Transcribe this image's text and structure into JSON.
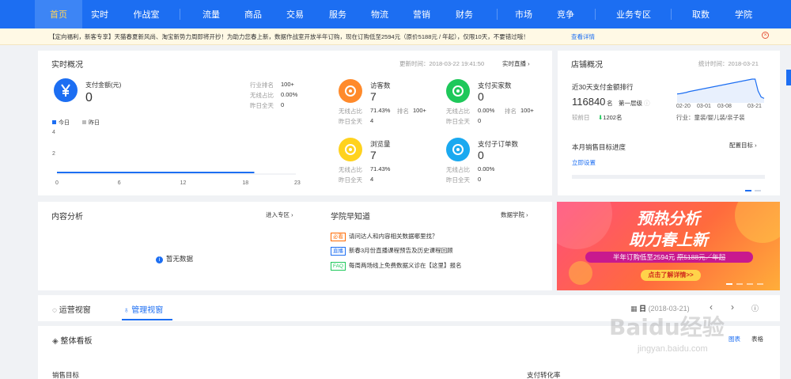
{
  "nav": {
    "items": [
      "首页",
      "实时",
      "作战室",
      "流量",
      "商品",
      "交易",
      "服务",
      "物流",
      "营销",
      "财务",
      "市场",
      "竞争",
      "业务专区",
      "取数",
      "学院"
    ],
    "active": "首页"
  },
  "notice": {
    "text": "【定向福利，新客专享】天猫春夏新风尚、淘宝新势力周即将开抄！为助力您春上新，数据作战室开放半年订购，现在订购低至2594元（原价5188元 / 年起），仅限10天，不要错过哦！",
    "link": "查看详情"
  },
  "realtime": {
    "title": "实时概况",
    "update_time": "更新时间：2018-03-22 19:41:50",
    "live_link": "实时直播",
    "pay_amount": {
      "label": "支付金额(元)",
      "value": "0"
    },
    "rank_rows": [
      {
        "label": "行业排名",
        "value": "100+"
      },
      {
        "label": "无线占比",
        "value": "0.00%"
      },
      {
        "label": "昨日全天",
        "value": "0"
      }
    ],
    "legend": {
      "today": "今日",
      "yesterday": "昨日"
    },
    "chart_data": {
      "type": "line",
      "x_ticks": [
        "0",
        "6",
        "12",
        "18",
        "23"
      ],
      "y_ticks": [
        "4",
        "2"
      ],
      "series": [
        {
          "name": "今日",
          "x": [
            0,
            19
          ],
          "values": [
            0,
            0
          ]
        }
      ],
      "xlim": [
        0,
        23
      ],
      "ylim": [
        0,
        4
      ]
    },
    "metrics": [
      {
        "name": "访客数",
        "value": "7",
        "r1_label": "无线占比",
        "r1_value": "71.43%",
        "r1_extra_label": "排名",
        "r1_extra_value": "100+",
        "r2_label": "昨日全天",
        "r2_value": "4",
        "icon": "footprint-icon",
        "color": "#ff8a2b"
      },
      {
        "name": "支付买家数",
        "value": "0",
        "r1_label": "无线占比",
        "r1_value": "0.00%",
        "r1_extra_label": "排名",
        "r1_extra_value": "100+",
        "r2_label": "昨日全天",
        "r2_value": "0",
        "icon": "users-icon",
        "color": "#1ec85a"
      },
      {
        "name": "浏览量",
        "value": "7",
        "r1_label": "无线占比",
        "r1_value": "71.43%",
        "r1_extra_label": "",
        "r1_extra_value": "",
        "r2_label": "昨日全天",
        "r2_value": "4",
        "icon": "eye-icon",
        "color": "#ffd21e"
      },
      {
        "name": "支付子订单数",
        "value": "0",
        "r1_label": "无线占比",
        "r1_value": "0.00%",
        "r1_extra_label": "",
        "r1_extra_value": "",
        "r2_label": "昨日全天",
        "r2_value": "0",
        "icon": "order-icon",
        "color": "#1aa9f0"
      }
    ]
  },
  "store": {
    "title": "店铺概况",
    "stat_time": "统计时间：2018-03-21",
    "rank_title": "近30天支付金额排行",
    "rank_value": "116840",
    "rank_unit": "名",
    "tier": "第一层级",
    "compare_label": "较前日",
    "compare_value": "1202名",
    "industry": "行业：童装/婴儿装/亲子装",
    "chart_data": {
      "type": "area",
      "x_ticks": [
        "02-20",
        "03-01",
        "03-08",
        "03-21"
      ],
      "values": [
        30,
        31,
        33,
        35,
        38,
        40,
        42,
        44,
        46,
        48,
        50,
        52,
        54,
        56,
        58,
        60,
        62,
        64,
        66,
        68,
        70,
        72,
        74,
        76,
        78,
        80,
        80,
        40,
        20,
        15
      ]
    },
    "target_title": "本月销售目标进度",
    "target_config": "配置目标",
    "target_setup": "立即设置"
  },
  "content": {
    "title": "内容分析",
    "enter": "进入专区",
    "empty": "暂无数据"
  },
  "academy": {
    "title": "学院早知道",
    "link": "数据学院",
    "items": [
      {
        "tag": "必看",
        "tag_color": "#ff6a00",
        "text": "请问达人和内容相关数据哪里找？"
      },
      {
        "tag": "直播",
        "tag_color": "#1c6ef2",
        "text": "新春3月份直播课程预告及历史课程回顾"
      },
      {
        "tag": "FAQ",
        "tag_color": "#1ec85a",
        "text": "每周两场线上免费数据义诊在【这里】报名"
      }
    ]
  },
  "banner": {
    "line1": "预热分析",
    "line2": "助力春上新",
    "offer_prefix": "半年订购低至2594元",
    "offer_strike": "原5188元／年起",
    "button": "点击了解详情>>"
  },
  "tabs": {
    "items": [
      "运营视窗",
      "管理视窗"
    ],
    "active": "管理视窗",
    "date_label": "日",
    "date_value": "(2018-03-21)"
  },
  "board": {
    "title": "整体看板",
    "view_chart": "图表",
    "view_table": "表格",
    "left_label": "销售目标",
    "right_label": "支付转化率"
  },
  "watermark": {
    "line1": "Baidu经验",
    "line2": "jingyan.baidu.com"
  }
}
